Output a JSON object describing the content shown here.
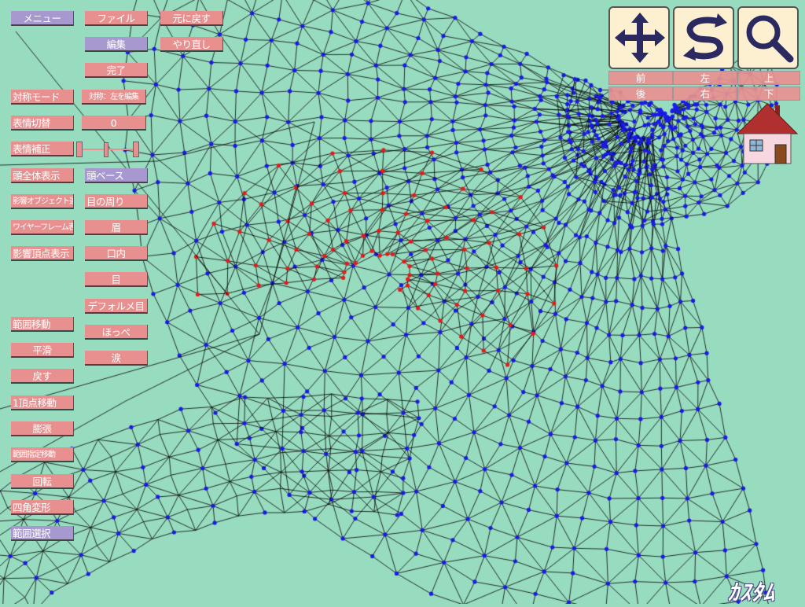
{
  "colors": {
    "background": "#98dcc0",
    "mesh_line": "#000000",
    "vertex": "#1a1ae6",
    "selected_vertex": "#e61a1a",
    "button": "#e89090",
    "button_alt": "#a898d0"
  },
  "menu": {
    "menu": "メニュー",
    "file": "ファイル",
    "undo": "元に戻す",
    "edit": "編集",
    "redo": "やり直し",
    "done": "完了"
  },
  "left": {
    "symmetry_mode": "対称モード",
    "symmetry_value": "対称：左を編集",
    "expression_switch": "表情切替",
    "expression_value": "0",
    "expression_correct": "表情補正",
    "head_all": "頭全体表示",
    "head_base": "頭ベース",
    "affect_object": "影響オブジェクト選択",
    "eye_around": "目の周り",
    "wireframe": "ワイヤーフレーム表示",
    "brow": "眉",
    "affect_vertex": "影響頂点表示",
    "mouth": "口内",
    "eye": "目",
    "deformed_eye": "デフォルメ目",
    "cheek": "ほっぺ",
    "tears": "涙"
  },
  "tools": {
    "range_move": "範囲移動",
    "smooth": "平滑",
    "undo": "戻す",
    "vertex_move": "1頂点移動",
    "inflate": "膨張",
    "range_specified_move": "範囲指定移動",
    "rotate": "回転",
    "quad_transform": "四角変形",
    "range_select": "範囲選択"
  },
  "view": {
    "icons": [
      "move-cross-icon",
      "rotate-arrows-icon",
      "zoom-magnifier-icon"
    ],
    "front": "前",
    "left": "左",
    "up": "上",
    "back": "後",
    "right": "右",
    "down": "下"
  },
  "home": {
    "icon": "house-icon"
  },
  "logo": "ｶｽﾀﾑ"
}
